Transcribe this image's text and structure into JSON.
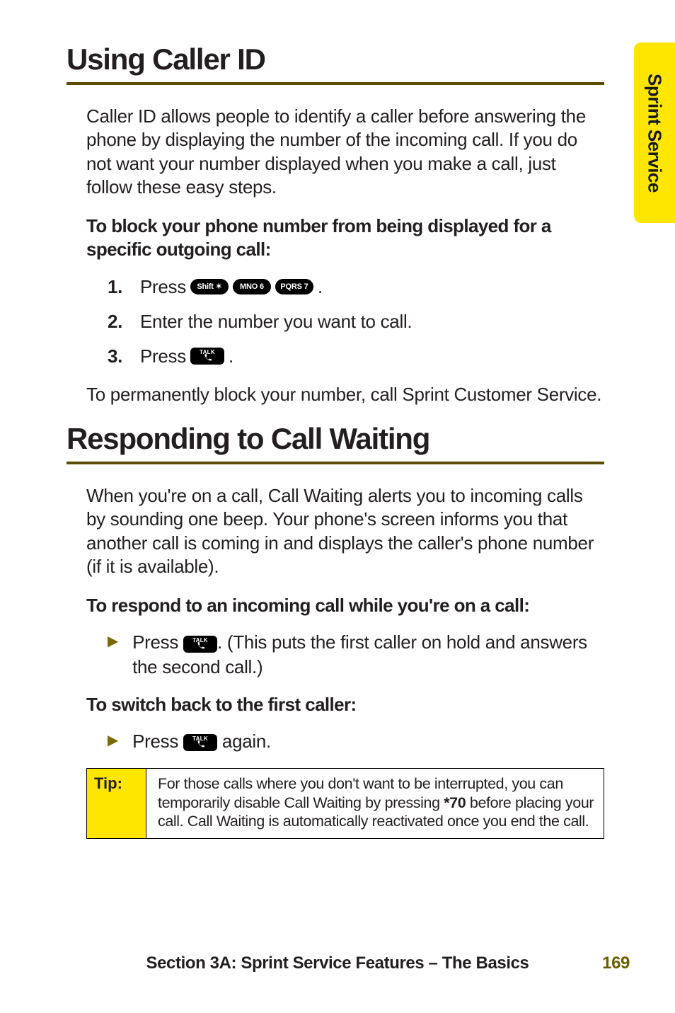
{
  "side_tab": "Sprint Service",
  "h1_a": "Using Caller ID",
  "p_caller_id": "Caller ID allows people to identify a caller before answering the phone by displaying the number of the incoming call. If you do not want your number displayed when you make a call, just follow these easy steps.",
  "p_block_heading": "To block your phone number from being displayed for a specific outgoing call:",
  "steps": {
    "1": {
      "num": "1.",
      "pre": "Press",
      "keys": [
        "Shift ✶",
        "MNO 6",
        "PQRS 7"
      ],
      "post": "."
    },
    "2": {
      "num": "2.",
      "text": "Enter the number you want to call."
    },
    "3": {
      "num": "3.",
      "pre": "Press",
      "post": "."
    }
  },
  "p_permanent": "To permanently block your number, call Sprint Customer Service.",
  "h1_b": "Responding to Call Waiting",
  "p_call_waiting": "When you're on a call, Call Waiting alerts you to incoming calls by sounding one beep. Your phone's screen informs you that another call is coming in and displays the caller's phone number (if it is available).",
  "p_respond_heading": "To respond to an incoming call while you're on a call:",
  "bullet_respond_pre": "Press",
  "bullet_respond_post": ". (This puts the first caller on hold and answers the second call.)",
  "p_switch_heading": "To switch back to the first caller:",
  "bullet_switch_pre": "Press",
  "bullet_switch_post": " again.",
  "tip_label": "Tip:",
  "tip_body_1": "For those calls where you don't want to be interrupted, you can temporarily disable Call Waiting by pressing ",
  "tip_keys": "*70",
  "tip_body_2": " before placing your call. Call Waiting is automatically reactivated once you end the call.",
  "footer_text": "Section 3A: Sprint Service Features – The Basics",
  "footer_page": "169"
}
